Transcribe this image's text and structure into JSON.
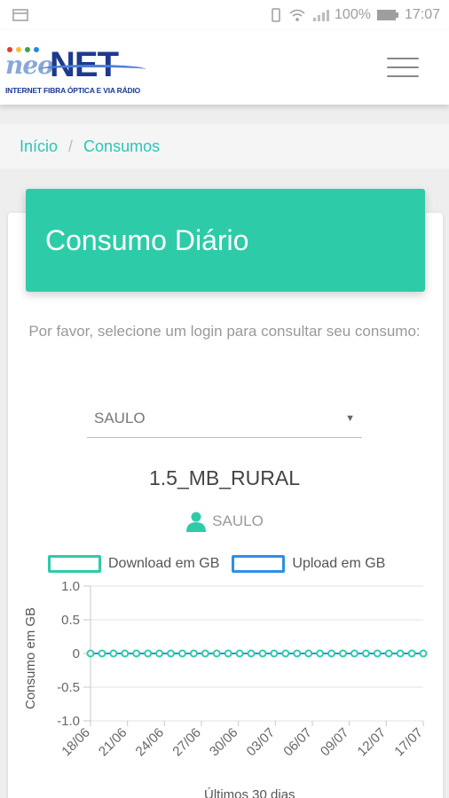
{
  "status_bar": {
    "battery": "100%",
    "time": "17:07"
  },
  "header": {
    "logo_text_neo": "neo",
    "logo_text_net": "NET",
    "logo_tagline": "INTERNET FIBRA ÓPTICA E VIA RÁDIO"
  },
  "breadcrumb": {
    "items": [
      "Início",
      "Consumos"
    ]
  },
  "card": {
    "title": "Consumo Diário",
    "prompt": "Por favor, selecione um login para consultar seu consumo:",
    "selected_login": "SAULO",
    "plan": "1.5_MB_RURAL",
    "user": "SAULO"
  },
  "colors": {
    "accent": "#2ecba8",
    "breadcrumb": "#2ec4b6",
    "upload": "#2f8ee6"
  },
  "chart_data": {
    "type": "line",
    "ylabel": "Consumo em GB",
    "xlabel": "Últimos 30 dias",
    "ylim": [
      -1.0,
      1.0
    ],
    "yticks": [
      "1.0",
      "0.5",
      "0",
      "-0.5",
      "-1.0"
    ],
    "x_tick_labels": [
      "18/06",
      "21/06",
      "24/06",
      "27/06",
      "30/06",
      "03/07",
      "06/07",
      "09/07",
      "12/07",
      "17/07"
    ],
    "legend_position": "top",
    "series": [
      {
        "name": "Download em GB",
        "color": "#2ecba8",
        "values": [
          0,
          0,
          0,
          0,
          0,
          0,
          0,
          0,
          0,
          0,
          0,
          0,
          0,
          0,
          0,
          0,
          0,
          0,
          0,
          0,
          0,
          0,
          0,
          0,
          0,
          0,
          0,
          0,
          0,
          0
        ]
      },
      {
        "name": "Upload em GB",
        "color": "#2f8ee6",
        "values": [
          0,
          0,
          0,
          0,
          0,
          0,
          0,
          0,
          0,
          0,
          0,
          0,
          0,
          0,
          0,
          0,
          0,
          0,
          0,
          0,
          0,
          0,
          0,
          0,
          0,
          0,
          0,
          0,
          0,
          0
        ]
      }
    ]
  }
}
